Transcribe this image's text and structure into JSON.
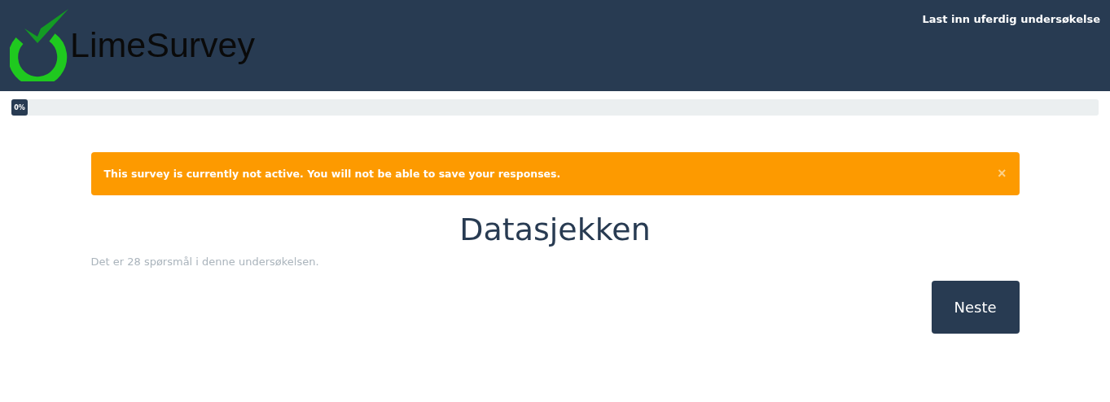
{
  "header": {
    "logo_text": "LimeSurvey",
    "load_link": "Last inn uferdig undersøkelse"
  },
  "progress": {
    "level": 0,
    "label": "0%"
  },
  "alert": {
    "message": "This survey is currently not active. You will not be able to save your responses.",
    "close": "×"
  },
  "survey": {
    "title": "Datasjekken",
    "description": "Det er 28 spørsmål i denne undersøkelsen."
  },
  "buttons": [
    "Neste"
  ]
}
